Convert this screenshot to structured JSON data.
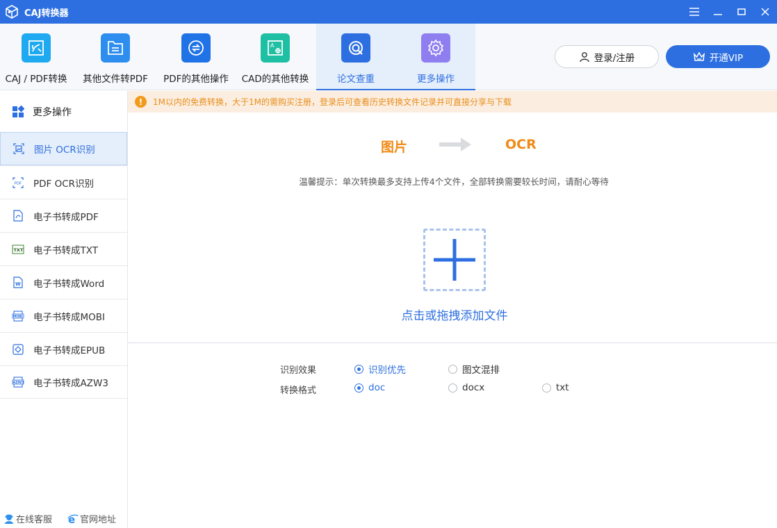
{
  "app": {
    "title": "CAJ转换器"
  },
  "toolbar": {
    "tools": [
      {
        "label": "CAJ / PDF转换",
        "icon": "caj-pdf-icon"
      },
      {
        "label": "其他文件转PDF",
        "icon": "folder-file-icon"
      },
      {
        "label": "PDF的其他操作",
        "icon": "pdf-swap-icon"
      },
      {
        "label": "CAD的其他转换",
        "icon": "cad-drawing-icon"
      },
      {
        "label": "论文查重",
        "icon": "magnifier-icon"
      },
      {
        "label": "更多操作",
        "icon": "gear-icon"
      }
    ],
    "active_tool": "更多操作",
    "login_label": "登录/注册",
    "vip_label": "开通VIP"
  },
  "sidebar": {
    "header": "更多操作",
    "items": [
      {
        "label": "图片 OCR识别",
        "icon": "image-ocr-icon"
      },
      {
        "label": "PDF OCR识别",
        "icon": "pdf-ocr-icon"
      },
      {
        "label": "电子书转成PDF",
        "icon": "ebook-pdf-icon"
      },
      {
        "label": "电子书转成TXT",
        "icon": "ebook-txt-icon"
      },
      {
        "label": "电子书转成Word",
        "icon": "ebook-word-icon"
      },
      {
        "label": "电子书转成MOBI",
        "icon": "ebook-mobi-icon"
      },
      {
        "label": "电子书转成EPUB",
        "icon": "ebook-epub-icon"
      },
      {
        "label": "电子书转成AZW3",
        "icon": "ebook-azw3-icon"
      }
    ],
    "active_item": "图片 OCR识别",
    "footer": {
      "service": "在线客服",
      "website": "官网地址"
    }
  },
  "main": {
    "notice": "1M以内的免费转换，大于1M的需购买注册，登录后可查看历史转换文件记录并可直接分享与下载",
    "conversion": {
      "from": "图片",
      "to": "OCR"
    },
    "tip": "温馨提示：单次转换最多支持上传4个文件，全部转换需要较长时间，请耐心等待",
    "drop_label": "点击或拖拽添加文件",
    "options": {
      "effect_label": "识别效果",
      "effect_choices": [
        "识别优先",
        "图文混排"
      ],
      "effect_selected": "识别优先",
      "format_label": "转换格式",
      "format_choices": [
        "doc",
        "docx",
        "txt"
      ],
      "format_selected": "doc"
    }
  },
  "colors": {
    "primary": "#2d6fe0",
    "accent": "#f08a16",
    "notice_bg": "#fbeee0"
  }
}
